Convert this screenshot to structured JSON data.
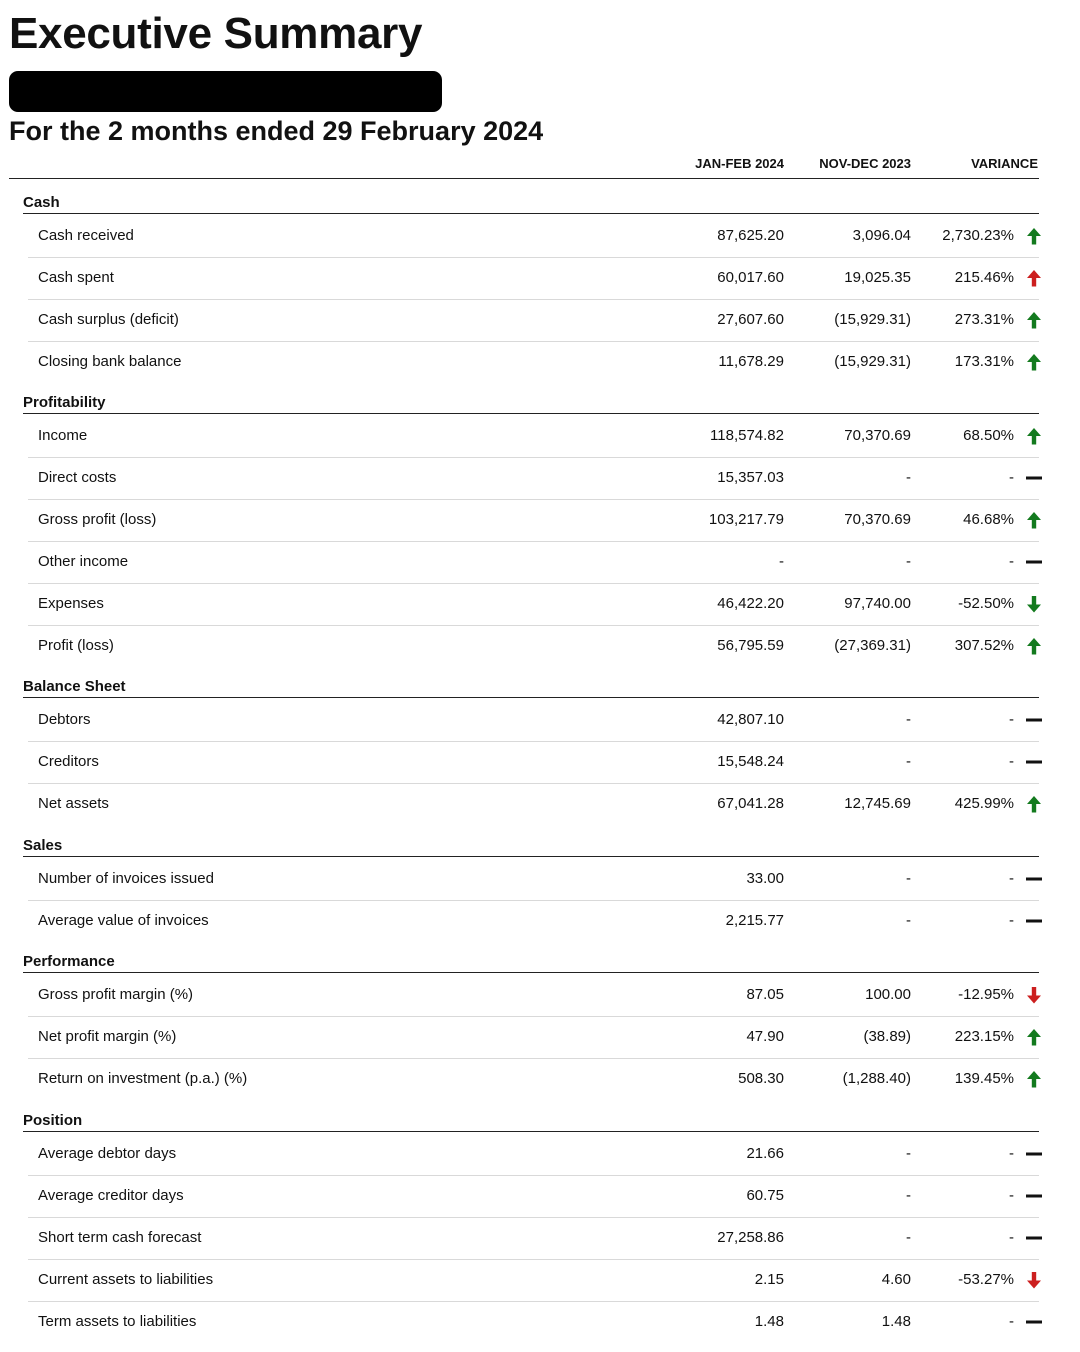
{
  "title": "Executive Summary",
  "subtitle": "For the 2 months ended 29 February 2024",
  "columns": [
    "JAN-FEB 2024",
    "NOV-DEC 2023",
    "VARIANCE"
  ],
  "colors": {
    "up_green": "#137a1e",
    "up_red": "#cc1f1f",
    "down_green": "#137a1e",
    "down_red": "#cc1f1f",
    "flat": "#111111"
  },
  "sections": [
    {
      "name": "Cash",
      "rows": [
        {
          "label": "Cash received",
          "current": "87,625.20",
          "previous": "3,096.04",
          "variance": "2,730.23%",
          "indicator": "up-green"
        },
        {
          "label": "Cash spent",
          "current": "60,017.60",
          "previous": "19,025.35",
          "variance": "215.46%",
          "indicator": "up-red"
        },
        {
          "label": "Cash surplus (deficit)",
          "current": "27,607.60",
          "previous": "(15,929.31)",
          "variance": "273.31%",
          "indicator": "up-green"
        },
        {
          "label": "Closing bank balance",
          "current": "11,678.29",
          "previous": "(15,929.31)",
          "variance": "173.31%",
          "indicator": "up-green"
        }
      ]
    },
    {
      "name": "Profitability",
      "rows": [
        {
          "label": "Income",
          "current": "118,574.82",
          "previous": "70,370.69",
          "variance": "68.50%",
          "indicator": "up-green"
        },
        {
          "label": "Direct costs",
          "current": "15,357.03",
          "previous": "-",
          "variance": "-",
          "indicator": "flat"
        },
        {
          "label": "Gross profit (loss)",
          "current": "103,217.79",
          "previous": "70,370.69",
          "variance": "46.68%",
          "indicator": "up-green"
        },
        {
          "label": "Other income",
          "current": "-",
          "previous": "-",
          "variance": "-",
          "indicator": "flat"
        },
        {
          "label": "Expenses",
          "current": "46,422.20",
          "previous": "97,740.00",
          "variance": "-52.50%",
          "indicator": "down-green"
        },
        {
          "label": "Profit (loss)",
          "current": "56,795.59",
          "previous": "(27,369.31)",
          "variance": "307.52%",
          "indicator": "up-green"
        }
      ]
    },
    {
      "name": "Balance Sheet",
      "rows": [
        {
          "label": "Debtors",
          "current": "42,807.10",
          "previous": "-",
          "variance": "-",
          "indicator": "flat"
        },
        {
          "label": "Creditors",
          "current": "15,548.24",
          "previous": "-",
          "variance": "-",
          "indicator": "flat"
        },
        {
          "label": "Net assets",
          "current": "67,041.28",
          "previous": "12,745.69",
          "variance": "425.99%",
          "indicator": "up-green"
        }
      ]
    },
    {
      "name": "Sales",
      "rows": [
        {
          "label": "Number of invoices issued",
          "current": "33.00",
          "previous": "-",
          "variance": "-",
          "indicator": "flat"
        },
        {
          "label": "Average value of invoices",
          "current": "2,215.77",
          "previous": "-",
          "variance": "-",
          "indicator": "flat"
        }
      ]
    },
    {
      "name": "Performance",
      "rows": [
        {
          "label": "Gross profit margin (%)",
          "current": "87.05",
          "previous": "100.00",
          "variance": "-12.95%",
          "indicator": "down-red"
        },
        {
          "label": "Net profit margin (%)",
          "current": "47.90",
          "previous": "(38.89)",
          "variance": "223.15%",
          "indicator": "up-green"
        },
        {
          "label": "Return on investment (p.a.) (%)",
          "current": "508.30",
          "previous": "(1,288.40)",
          "variance": "139.45%",
          "indicator": "up-green"
        }
      ]
    },
    {
      "name": "Position",
      "rows": [
        {
          "label": "Average debtor days",
          "current": "21.66",
          "previous": "-",
          "variance": "-",
          "indicator": "flat"
        },
        {
          "label": "Average creditor days",
          "current": "60.75",
          "previous": "-",
          "variance": "-",
          "indicator": "flat"
        },
        {
          "label": "Short term cash forecast",
          "current": "27,258.86",
          "previous": "-",
          "variance": "-",
          "indicator": "flat"
        },
        {
          "label": "Current assets to liabilities",
          "current": "2.15",
          "previous": "4.60",
          "variance": "-53.27%",
          "indicator": "down-red"
        },
        {
          "label": "Term assets to liabilities",
          "current": "1.48",
          "previous": "1.48",
          "variance": "-",
          "indicator": "flat"
        }
      ]
    }
  ]
}
